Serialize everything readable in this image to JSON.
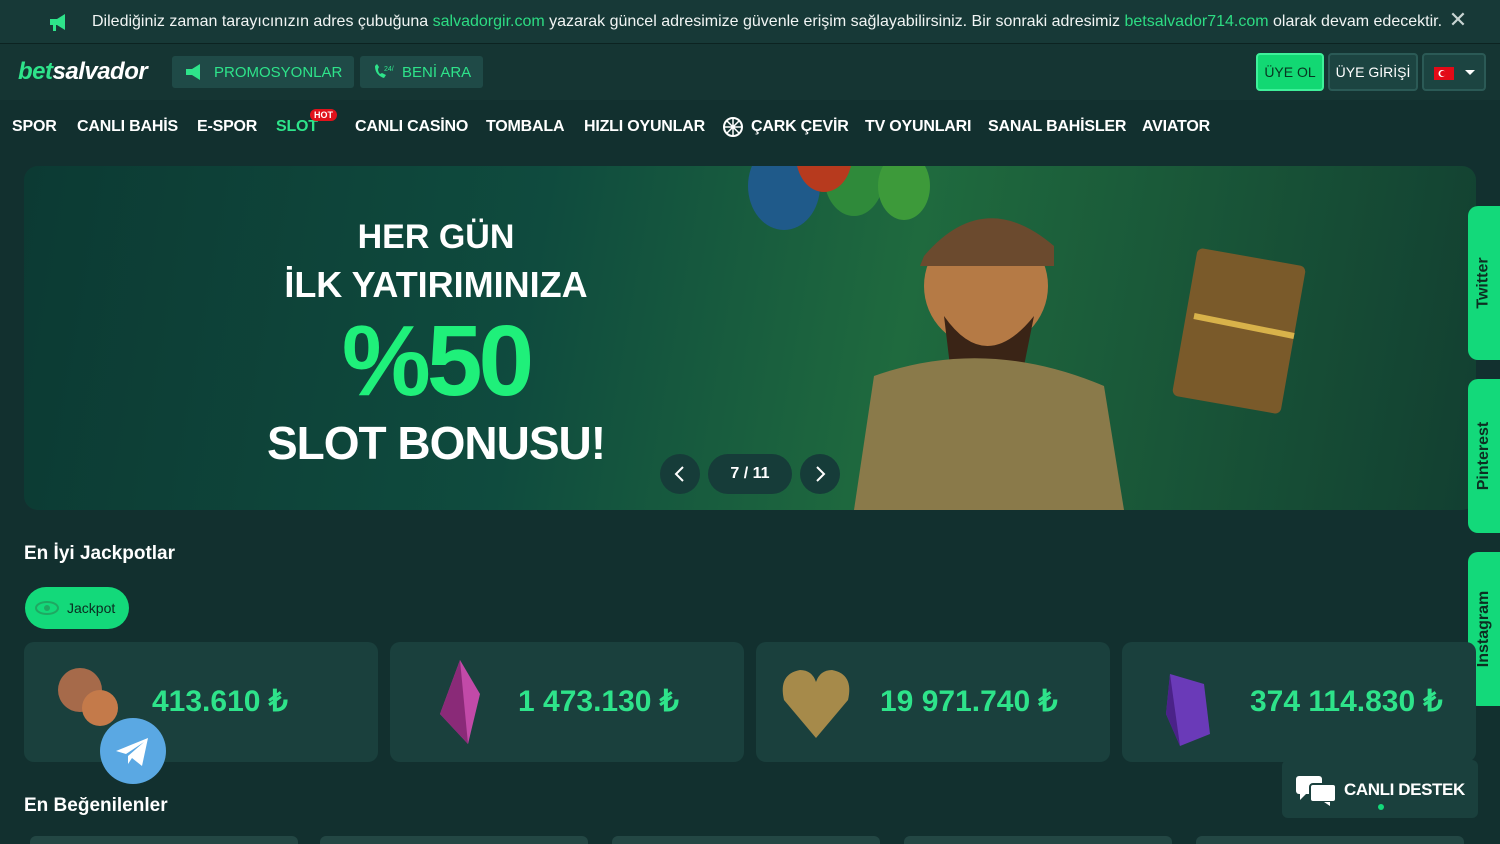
{
  "notice": {
    "text_before": "Dilediğiniz zaman tarayıcınızın adres çubuğuna",
    "link1": "salvadorgir.com",
    "text_middle": "yazarak güncel adresimize güvenle erişim sağlayabilirsiniz. Bir sonraki adresimiz",
    "link2": "betsalvador714.com",
    "text_after": "olarak devam edecektir.",
    "close_icon": "close-icon"
  },
  "header": {
    "logo_bet": "bet",
    "logo_salvador": "salvador",
    "promotions": "PROMOSYONLAR",
    "call_me": "BENİ ARA",
    "signup": "ÜYE OL",
    "login": "ÜYE GİRİŞİ"
  },
  "nav": {
    "items": [
      "SPOR",
      "CANLI BAHİS",
      "E-SPOR",
      "SLOT",
      "CANLI CASİNO",
      "TOMBALA",
      "HIZLI OYUNLAR",
      "ÇARK ÇEVİR",
      "TV OYUNLARI",
      "SANAL BAHİSLER",
      "AVIATOR"
    ],
    "hot_badge": "HOT"
  },
  "banner": {
    "line1": "HER GÜN",
    "line2": "İLK YATIRIMINIZA",
    "percent": "%50",
    "line3": "SLOT BONUSU!",
    "counter": "7 / 11"
  },
  "social": [
    "Twitter",
    "Pinterest",
    "Instagram"
  ],
  "jackpots": {
    "title": "En İyi Jackpotlar",
    "tab": "Jackpot",
    "amounts": [
      "413.610 ₺",
      "1 473.130 ₺",
      "19 971.740 ₺",
      "374 114.830 ₺"
    ]
  },
  "favorites": {
    "title": "En Beğenilenler"
  },
  "support": {
    "label": "CANLI DESTEK"
  },
  "colors": {
    "accent": "#2ee38a",
    "background": "#12302f",
    "hot": "#e0121b"
  }
}
